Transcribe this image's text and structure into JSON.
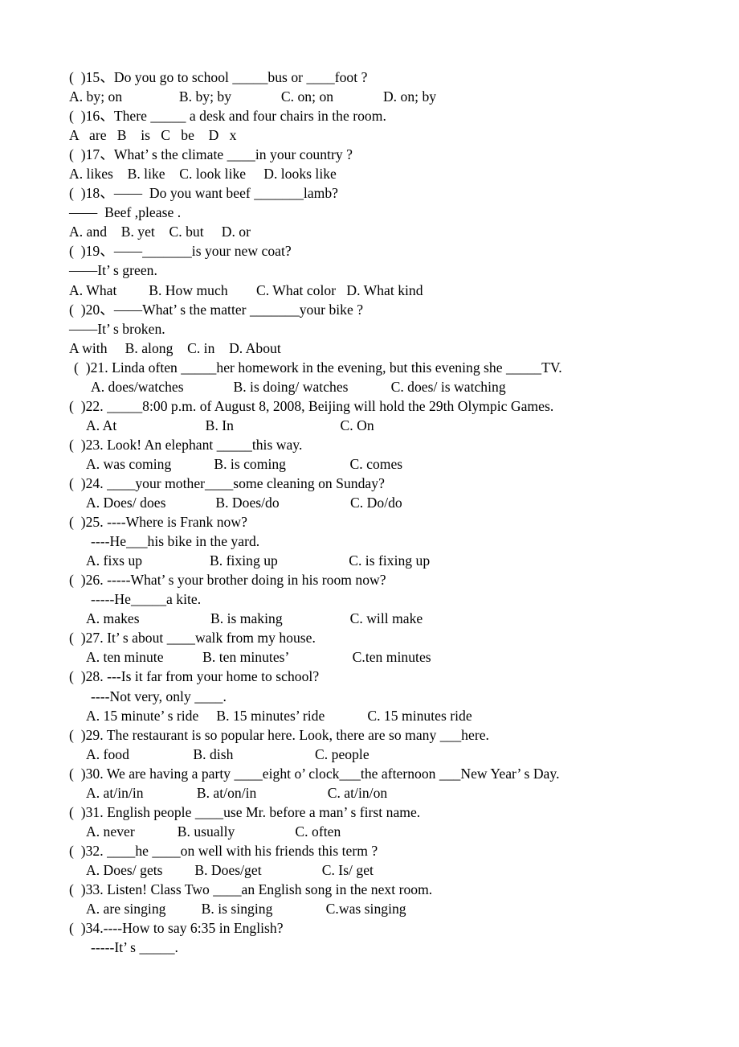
{
  "document": {
    "type": "english-grammar-worksheet",
    "background_color": "#ffffff",
    "text_color": "#000000",
    "questions": [
      {
        "number": "15",
        "stem": "(  )15、Do you go to school _____bus or ____foot ?",
        "options_line": "A. by; on                B. by; by              C. on; on              D. on; by"
      },
      {
        "number": "16",
        "stem": "(  )16、There _____ a desk and four chairs in the room.",
        "options_line": "A   are   B    is   C   be    D   x"
      },
      {
        "number": "17",
        "stem": "(  )17、What’ s the climate ____in your country ?",
        "options_line": "A. likes    B. like    C. look like     D. looks like"
      },
      {
        "number": "18",
        "stem": "(  )18、——  Do you want beef _______lamb?",
        "stem_line2": "——  Beef ,please .",
        "options_line": "A. and    B. yet    C. but     D. or"
      },
      {
        "number": "19",
        "stem": "(  )19、——_______is your new coat?",
        "stem_line2": "——It’ s green.",
        "options_line": "A. What         B. How much        C. What color   D. What kind"
      },
      {
        "number": "20",
        "stem": "(  )20、——What’ s the matter _______your bike ?",
        "stem_line2": "——It’ s broken.",
        "options_line": "A with     B. along    C. in    D. About"
      },
      {
        "number": "21",
        "stem": "(  )21. Linda often _____her homework in the evening, but this evening she _____TV.",
        "options_line": "A. does/watches              B. is doing/ watches            C. does/ is watching"
      },
      {
        "number": "22",
        "stem": "(  )22. _____8:00 p.m. of August 8, 2008, Beijing will hold the 29th Olympic Games.",
        "options_line": "A. At                         B. In                              C. On"
      },
      {
        "number": "23",
        "stem": "(  )23. Look! An elephant _____this way.",
        "options_line": "A. was coming            B. is coming                  C. comes"
      },
      {
        "number": "24",
        "stem": "(  )24. ____your mother____some cleaning on Sunday?",
        "options_line": "A. Does/ does              B. Does/do                    C. Do/do"
      },
      {
        "number": "25",
        "stem": "(  )25. ----Where is Frank now?",
        "stem_line2": "----He___his bike in the yard.",
        "options_line": "A. fixs up                   B. fixing up                    C. is fixing up"
      },
      {
        "number": "26",
        "stem": "(  )26. -----What’ s your brother doing in his room now?",
        "stem_line2": "-----He_____a kite.",
        "options_line": "A. makes                    B. is making                   C. will make"
      },
      {
        "number": "27",
        "stem": "(  )27. It’ s about ____walk from my house.",
        "options_line": "A. ten minute           B. ten minutes’                  C.ten minutes"
      },
      {
        "number": "28",
        "stem": "(  )28. ---Is it far from your home to school?",
        "stem_line2": "----Not very, only ____.",
        "options_line": "A. 15 minute’ s ride     B. 15 minutes’ ride            C. 15 minutes ride"
      },
      {
        "number": "29",
        "stem": "(  )29. The restaurant is so popular here. Look, there are so many ___here.",
        "options_line": "A. food                  B. dish                       C. people"
      },
      {
        "number": "30",
        "stem": "(  )30. We are having a party ____eight o’ clock___the afternoon ___New Year’ s Day.",
        "options_line": "A. at/in/in               B. at/on/in                    C. at/in/on"
      },
      {
        "number": "31",
        "stem": "(  )31. English people ____use Mr. before a man’ s first name.",
        "options_line": "A. never            B. usually                 C. often"
      },
      {
        "number": "32",
        "stem": "(  )32. ____he ____on well with his friends this term ?",
        "options_line": "A. Does/ gets         B. Does/get                 C. Is/ get"
      },
      {
        "number": "33",
        "stem": "(  )33. Listen! Class Two ____an English song in the next room.",
        "options_line": "A. are singing          B. is singing               C.was singing"
      },
      {
        "number": "34",
        "stem": "(  )34.----How to say 6:35 in English?",
        "stem_line2": "-----It’ s _____."
      }
    ]
  }
}
